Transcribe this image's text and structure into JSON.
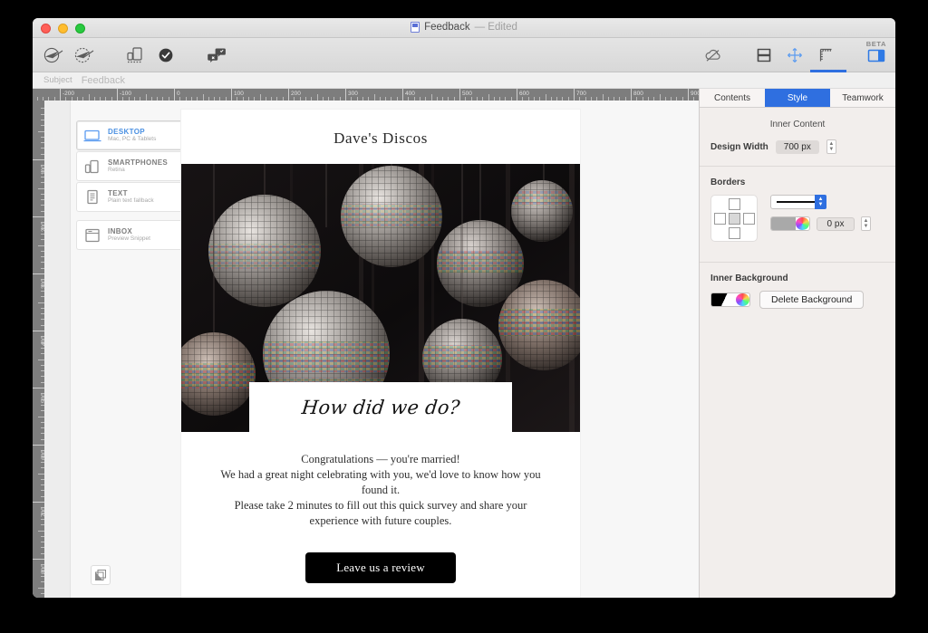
{
  "window": {
    "title": "Feedback",
    "title_state": "— Edited",
    "doc_icon": "document-icon",
    "traffic_lights": [
      "close-button",
      "minimize-button",
      "zoom-button"
    ]
  },
  "toolbar": {
    "left_items": [
      {
        "name": "send-icon",
        "label": "Send"
      },
      {
        "name": "send-test-icon",
        "label": "Send Test"
      },
      {
        "name": "device-preview-icon",
        "label": "Preview"
      },
      {
        "name": "validate-check-icon",
        "label": "Validate"
      },
      {
        "name": "comments-icon",
        "label": "Comments"
      }
    ],
    "right_items": [
      {
        "name": "cloud-icon",
        "label": "Cloud"
      },
      {
        "name": "layout-icon",
        "label": "Layout"
      },
      {
        "name": "move-arrows-icon",
        "label": "Move"
      },
      {
        "name": "ruler-icon",
        "label": "Ruler"
      },
      {
        "name": "inspector-panel-icon",
        "label": "Inspector"
      }
    ],
    "beta_label": "BETA"
  },
  "subject_bar": {
    "label": "Subject",
    "value": "Feedback"
  },
  "rulers": {
    "horizontal_ticks": [
      "-200",
      "-100",
      "0",
      "100",
      "200",
      "300",
      "400",
      "500",
      "600",
      "700",
      "800",
      "900"
    ],
    "vertical_ticks": [
      "100",
      "200",
      "300",
      "400",
      "500",
      "600",
      "700",
      "800"
    ]
  },
  "device_list": [
    {
      "name": "sidebar-item-desktop",
      "icon": "desktop-monitor-icon",
      "title": "DESKTOP",
      "subtitle": "Mac, PC & Tablets",
      "selected": true
    },
    {
      "name": "sidebar-item-smartphones",
      "icon": "smartphone-icon",
      "title": "SMARTPHONES",
      "subtitle": "Retina",
      "selected": false
    },
    {
      "name": "sidebar-item-text",
      "icon": "text-document-icon",
      "title": "TEXT",
      "subtitle": "Plain text fallback",
      "selected": false
    },
    {
      "name": "sidebar-item-inbox",
      "icon": "inbox-preview-icon",
      "title": "INBOX",
      "subtitle": "Preview Snippet",
      "selected": false
    }
  ],
  "email": {
    "brand": "Dave's Discos",
    "hero_alt": "disco-balls-photo",
    "script_heading": "How did we do?",
    "body_lines": [
      "Congratulations — you're married!",
      "We had a great night celebrating with you, we'd love to know how you found it.",
      "Please take 2 minutes to fill out this quick survey and share your experience with future couples."
    ],
    "cta_label": "Leave us a review"
  },
  "canvas": {
    "layers_button": "layers-icon"
  },
  "inspector": {
    "tabs": [
      {
        "name": "tab-contents",
        "label": "Contents",
        "active": false
      },
      {
        "name": "tab-style",
        "label": "Style",
        "active": true
      },
      {
        "name": "tab-teamwork",
        "label": "Teamwork",
        "active": false
      }
    ],
    "section_title": "Inner Content",
    "design_width_label": "Design Width",
    "design_width_value": "700 px",
    "borders_label": "Borders",
    "border_width_value": "0 px",
    "inner_background_label": "Inner Background",
    "delete_background_label": "Delete Background"
  },
  "colors": {
    "accent_blue": "#2f6fe0",
    "toolbar_gray": "#dcdcdc",
    "inspector_bg": "#f2eeec",
    "ruler_gray": "#7d7d7d",
    "cta_black": "#000000"
  }
}
